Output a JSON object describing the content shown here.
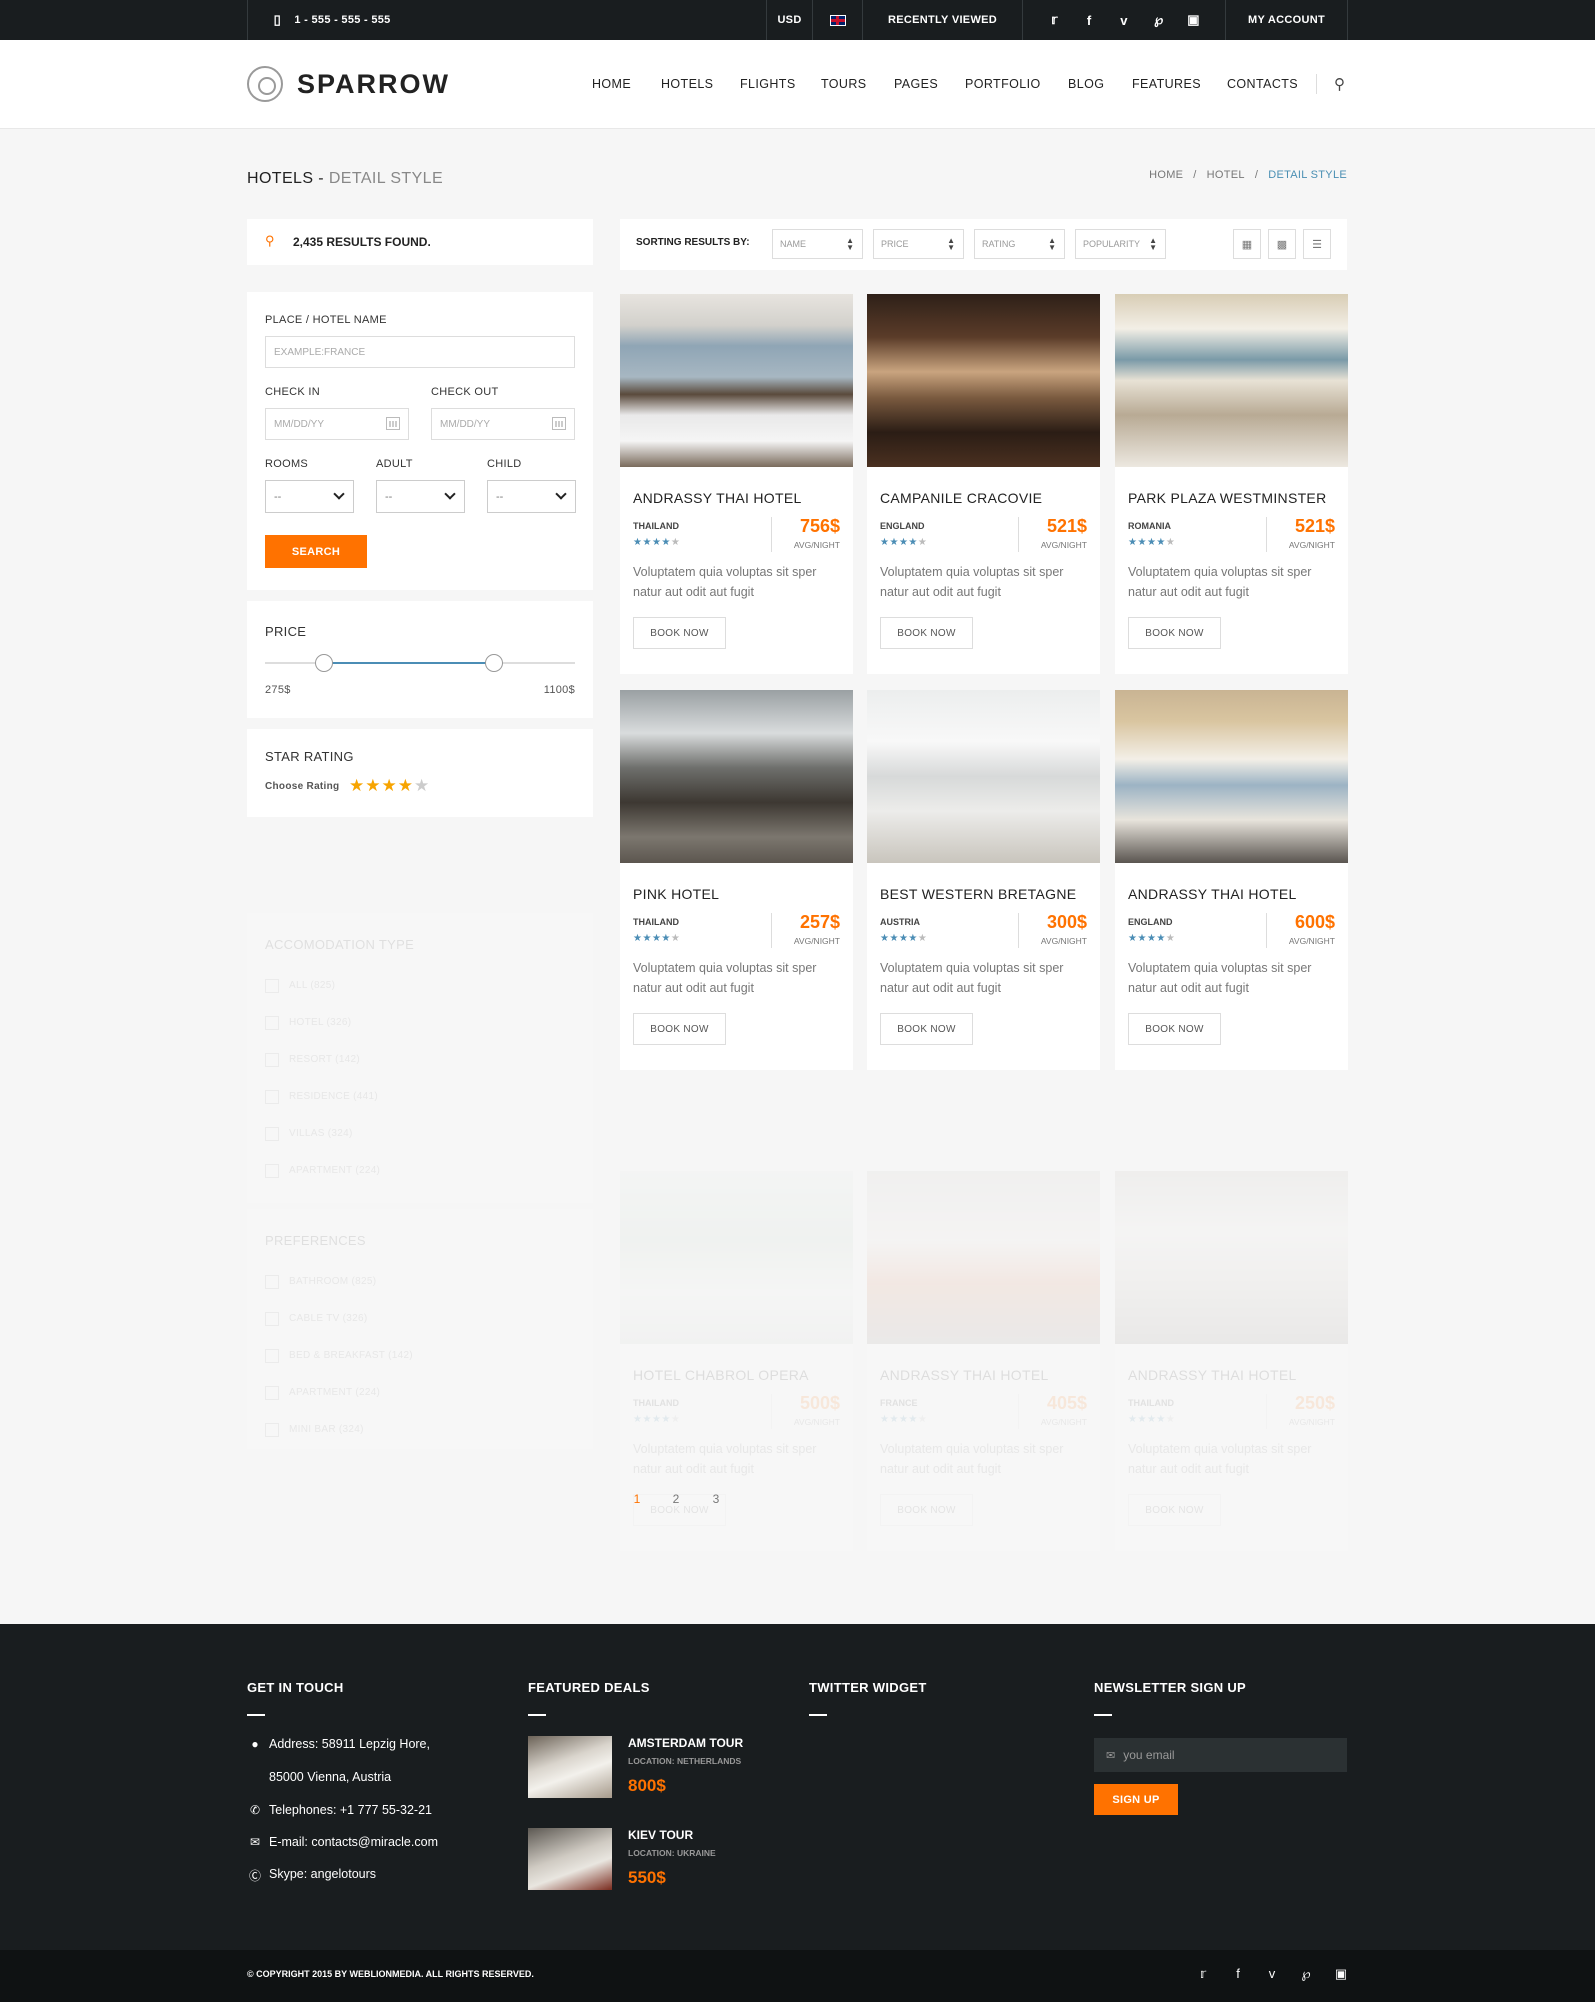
{
  "topbar": {
    "phone": "1 - 555 - 555 - 555",
    "currency": "USD",
    "language_flag": "uk-flag",
    "recently_viewed": "RECENTLY VIEWED",
    "my_account": "MY ACCOUNT",
    "social_icons": [
      "twitter-icon",
      "facebook-icon",
      "vimeo-icon",
      "pinterest-icon",
      "instagram-icon"
    ]
  },
  "header": {
    "logo": "SPARROW",
    "nav": [
      "HOME",
      "HOTELS",
      "FLIGHTS",
      "TOURS",
      "PAGES",
      "PORTFOLIO",
      "BLOG",
      "FEATURES",
      "CONTACTS"
    ]
  },
  "page": {
    "title": "HOTELS",
    "title_sep": " - ",
    "subtitle": "DETAIL STYLE",
    "breadcrumb": [
      "HOME",
      "HOTEL",
      "DETAIL STYLE"
    ],
    "breadcrumb_sep": "/"
  },
  "results": {
    "count_text": "2,435 RESULTS FOUND."
  },
  "search": {
    "place_label": "PLACE / HOTEL NAME",
    "place_placeholder": "EXAMPLE:FRANCE",
    "checkin_label": "CHECK IN",
    "checkin_placeholder": "MM/DD/YY",
    "checkout_label": "CHECK OUT",
    "checkout_placeholder": "MM/DD/YY",
    "rooms_label": "ROOMS",
    "adult_label": "ADULT",
    "child_label": "CHILD",
    "rooms_value": "--",
    "adult_value": "--",
    "child_value": "--",
    "button": "SEARCH"
  },
  "price_filter": {
    "title": "PRICE",
    "min": "275$",
    "max": "1100$",
    "low_fraction": 0.19,
    "high_fraction": 0.74
  },
  "star_filter": {
    "title": "STAR RATING",
    "label": "Choose Rating",
    "rating": 4,
    "max": 5
  },
  "accommodation": {
    "title": "ACCOMODATION TYPE",
    "items": [
      "ALL (825)",
      "HOTEL (326)",
      "RESORT (142)",
      "RESIDENCE (441)",
      "VILLAS (324)",
      "APARTMENT (224)"
    ]
  },
  "preferences": {
    "title": "PREFERENCES",
    "items": [
      "BATHROOM (825)",
      "CABLE TV (326)",
      "BED & BREAKFAST (142)",
      "APARTMENT (224)",
      "MINI BAR (324)"
    ]
  },
  "sorting": {
    "label": "SORTING RESULTS BY:",
    "options": [
      "NAME",
      "PRICE",
      "RATING",
      "POPULARITY"
    ],
    "view_icons": [
      "grid-large-icon",
      "grid-small-icon",
      "list-icon"
    ]
  },
  "hotels": [
    {
      "name": "ANDRASSY THAI HOTEL",
      "country": "THAILAND",
      "stars": 4,
      "price": "756$",
      "unit": "AVG/NIGHT",
      "desc": "Voluptatem quia voluptas sit sper natur aut odit aut fugit",
      "button": "BOOK NOW",
      "img": "bedroom-sea-view"
    },
    {
      "name": "CAMPANILE CRACOVIE",
      "country": "ENGLAND",
      "stars": 4,
      "price": "521$",
      "unit": "AVG/NIGHT",
      "desc": "Voluptatem quia voluptas sit sper natur aut odit aut fugit",
      "button": "BOOK NOW",
      "img": "dining-room"
    },
    {
      "name": "PARK PLAZA WESTMINSTER",
      "country": "ROMANIA",
      "stars": 4,
      "price": "521$",
      "unit": "AVG/NIGHT",
      "desc": "Voluptatem quia voluptas sit sper natur aut odit aut fugit",
      "button": "BOOK NOW",
      "img": "bright-bedroom"
    },
    {
      "name": "PINK HOTEL",
      "country": "THAILAND",
      "stars": 4,
      "price": "257$",
      "unit": "AVG/NIGHT",
      "desc": "Voluptatem quia voluptas sit sper natur aut odit aut fugit",
      "button": "BOOK NOW",
      "img": "living-room-dark"
    },
    {
      "name": "BEST WESTERN BRETAGNE",
      "country": "AUSTRIA",
      "stars": 4,
      "price": "300$",
      "unit": "AVG/NIGHT",
      "desc": "Voluptatem quia voluptas sit sper natur aut odit aut fugit",
      "button": "BOOK NOW",
      "img": "white-living-room"
    },
    {
      "name": "ANDRASSY THAI HOTEL",
      "country": "ENGLAND",
      "stars": 4,
      "price": "600$",
      "unit": "AVG/NIGHT",
      "desc": "Voluptatem quia voluptas sit sper natur aut odit aut fugit",
      "button": "BOOK NOW",
      "img": "loft-living-room"
    },
    {
      "name": "HOTEL CHABROL OPERA",
      "country": "THAILAND",
      "stars": 4,
      "price": "500$",
      "unit": "AVG/NIGHT",
      "desc": "Voluptatem quia voluptas sit sper natur aut odit aut fugit",
      "button": "BOOK NOW",
      "img": "sunroom"
    },
    {
      "name": "ANDRASSY THAI HOTEL",
      "country": "FRANCE",
      "stars": 4,
      "price": "405$",
      "unit": "AVG/NIGHT",
      "desc": "Voluptatem quia voluptas sit sper natur aut odit aut fugit",
      "button": "BOOK NOW",
      "img": "bedroom-orange"
    },
    {
      "name": "ANDRASSY THAI HOTEL",
      "country": "THAILAND",
      "stars": 4,
      "price": "250$",
      "unit": "AVG/NIGHT",
      "desc": "Voluptatem quia voluptas sit sper natur aut odit aut fugit",
      "button": "BOOK NOW",
      "img": "terrace"
    }
  ],
  "pagination": {
    "pages": [
      "1",
      "2",
      "3"
    ],
    "current": "1"
  },
  "footer": {
    "contact_title": "GET IN TOUCH",
    "address_1": "Address: 58911 Lepzig Hore,",
    "address_2": "85000 Vienna, Austria",
    "phone": "Telephones: +1 777 55-32-21",
    "email": "E-mail: contacts@miracle.com",
    "skype": "Skype: angelotours",
    "deals_title": "FEATURED DEALS",
    "deals": [
      {
        "title": "AMSTERDAM TOUR",
        "location": "LOCATION: NETHERLANDS",
        "price": "800$"
      },
      {
        "title": "KIEV TOUR",
        "location": "LOCATION: UKRAINE",
        "price": "550$"
      }
    ],
    "twitter_title": "TWITTER WIDGET",
    "newsletter_title": "NEWSLETTER SIGN UP",
    "newsletter_placeholder": "you email",
    "signup_button": "SIGN UP",
    "copyright": "© COPYRIGHT 2015 BY WEBLIONMEDIA. ALL RIGHTS RESERVED."
  },
  "colors": {
    "accent": "#ff7200",
    "link": "#4a8fb3",
    "dark": "#191d1f"
  }
}
